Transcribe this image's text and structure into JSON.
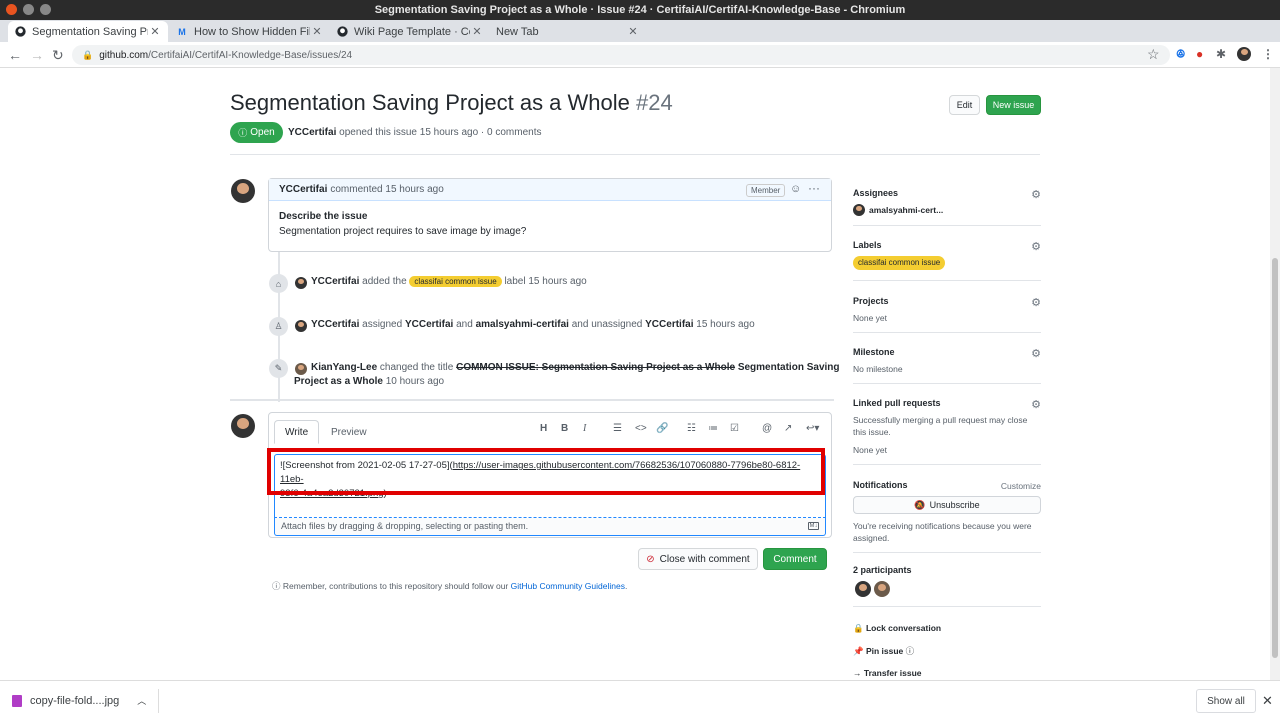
{
  "window": {
    "title": "Segmentation Saving Project as a Whole · Issue #24 · CertifaiAI/CertifAI-Knowledge-Base - Chromium"
  },
  "tabs": [
    {
      "label": "Segmentation Saving Pro",
      "icon": "github-icon"
    },
    {
      "label": "How to Show Hidden Files",
      "icon": "m-icon"
    },
    {
      "label": "Wiki Page Template · Certi",
      "icon": "github-icon"
    },
    {
      "label": "New Tab",
      "icon": ""
    }
  ],
  "address": {
    "domain": "github.com",
    "path": "/CertifaiAI/CertifAI-Knowledge-Base/issues/24"
  },
  "issue": {
    "title": "Segmentation Saving Project as a Whole",
    "number": "#24",
    "edit_label": "Edit",
    "new_issue_label": "New issue",
    "state": "Open",
    "author": "YCCertifai",
    "meta": "opened this issue 15 hours ago · 0 comments"
  },
  "comment": {
    "author": "YCCertifai",
    "time": "commented 15 hours ago",
    "badge": "Member",
    "heading": "Describe the issue",
    "body": "Segmentation project requires to save image by image?"
  },
  "events": [
    {
      "actor": "YCCertifai",
      "pre": "added the",
      "label": "classifai common issue",
      "post": "label 15 hours ago"
    },
    {
      "actor": "YCCertifai",
      "t1": "assigned",
      "u1": "YCCertifai",
      "t2": "and",
      "u2": "amalsyahmi-certifai",
      "t3": "and unassigned",
      "u3": "YCCertifai",
      "t4": "15 hours ago"
    },
    {
      "actor": "KianYang-Lee",
      "pre": "changed the title",
      "old": "COMMON ISSUE: Segmentation Saving Project as a Whole",
      "new1": "Segmentation Saving",
      "new2": "Project as a Whole",
      "time": "10 hours ago"
    }
  ],
  "editor": {
    "tab_write": "Write",
    "tab_preview": "Preview",
    "text_line1_plain": "![Screenshot from 2021-02-05 17-27-05](",
    "text_line1_link": "https://user-images.githubusercontent.com/76682536/107060880-7796be80-6812-11eb-",
    "text_line2_link": "93f6-4a4ea2d30721.png",
    "text_line2_plain": ")",
    "attach_hint": "Attach files by dragging & dropping, selecting or pasting them.",
    "close_label": "Close with comment",
    "comment_label": "Comment"
  },
  "remember": {
    "text": "Remember, contributions to this repository should follow our",
    "link": "GitHub Community Guidelines",
    "end": "."
  },
  "sidebar": {
    "assignees": {
      "heading": "Assignees",
      "value": "amalsyahmi-cert..."
    },
    "labels": {
      "heading": "Labels",
      "value": "classifai common issue"
    },
    "projects": {
      "heading": "Projects",
      "value": "None yet"
    },
    "milestone": {
      "heading": "Milestone",
      "value": "No milestone"
    },
    "linked": {
      "heading": "Linked pull requests",
      "desc": "Successfully merging a pull request may close this issue.",
      "value": "None yet"
    },
    "notifications": {
      "heading": "Notifications",
      "customize": "Customize",
      "unsubscribe": "Unsubscribe",
      "desc": "You're receiving notifications because you were assigned."
    },
    "participants": {
      "heading": "2 participants"
    },
    "actions": {
      "lock": "Lock conversation",
      "pin": "Pin issue",
      "transfer": "Transfer issue"
    }
  },
  "downloads": {
    "file": "copy-file-fold....jpg",
    "show_all": "Show all"
  },
  "colors": {
    "accent_green": "#2ea44f",
    "label_yellow": "#f4cd31",
    "highlight_red": "#e00000",
    "link_blue": "#0366d6"
  }
}
